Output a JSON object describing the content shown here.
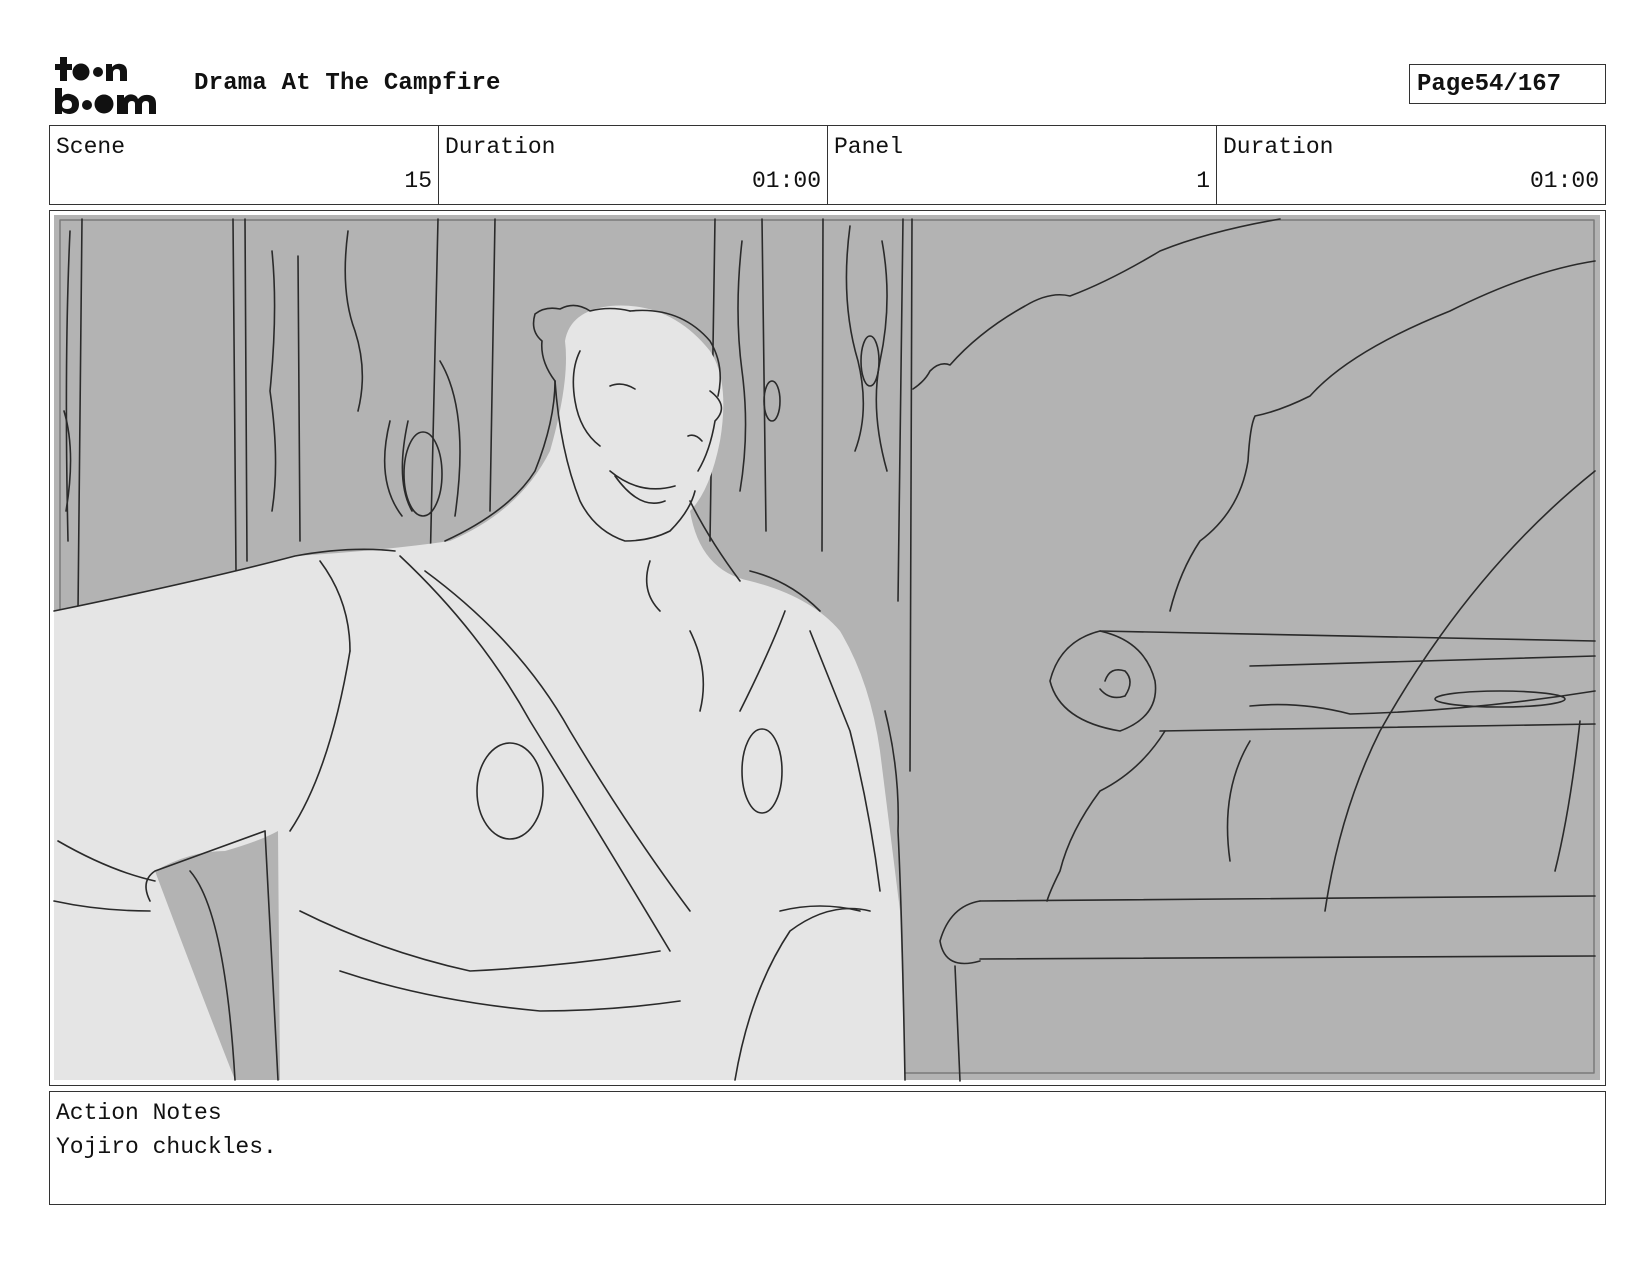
{
  "header": {
    "logo_text": "toonboom",
    "title": "Drama At The Campfire",
    "page_label": "Page",
    "page_value": "54/167"
  },
  "info": {
    "scene_label": "Scene",
    "scene_value": "15",
    "scene_duration_label": "Duration",
    "scene_duration_value": "01:00",
    "panel_label": "Panel",
    "panel_value": "1",
    "panel_duration_label": "Duration",
    "panel_duration_value": "01:00"
  },
  "artwork": {
    "subject": "storyboard-sketch",
    "colors": {
      "background_gray": "#b3b3b3",
      "figure_light": "#e5e5e5",
      "line": "#2a2a2a"
    }
  },
  "notes": {
    "label": "Action Notes",
    "text": "Yojiro chuckles."
  }
}
